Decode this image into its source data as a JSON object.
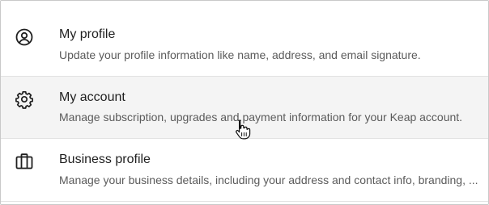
{
  "menu": {
    "items": [
      {
        "icon": "user-circle-icon",
        "title": "My profile",
        "description": "Update your profile information like name, address, and email signature."
      },
      {
        "icon": "gear-icon",
        "title": "My account",
        "description": "Manage subscription, upgrades and payment information for your Keap account."
      },
      {
        "icon": "briefcase-icon",
        "title": "Business profile",
        "description": "Manage your business details, including your address and contact info, branding, ..."
      }
    ]
  },
  "colors": {
    "hover_background": "#f4f4f4",
    "title_text": "#1f1f1f",
    "description_text": "#5b5b5b",
    "divider": "#e2e2e2"
  },
  "cursor": {
    "type": "hand-pointer-icon"
  }
}
